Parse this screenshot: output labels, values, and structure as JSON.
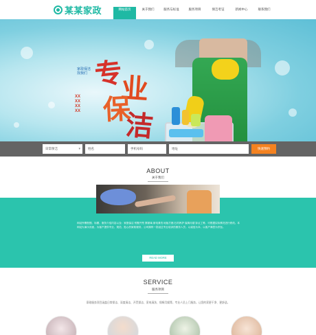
{
  "header": {
    "logo_text": "某某家政",
    "nav": [
      {
        "label": "网站首页",
        "active": true
      },
      {
        "label": "关于我们",
        "active": false
      },
      {
        "label": "服务与标准",
        "active": false
      },
      {
        "label": "服务项目",
        "active": false
      },
      {
        "label": "保洁考证",
        "active": false
      },
      {
        "label": "新闻中心",
        "active": false
      },
      {
        "label": "联系我们",
        "active": false
      }
    ]
  },
  "banner": {
    "calligraphy": [
      "专",
      "业",
      "保",
      "洁"
    ],
    "slogan_vertical": "家政保洁 找我们",
    "phone": "XXXXXXXX"
  },
  "search": {
    "select_value": "日常保洁",
    "name_placeholder": "姓名",
    "phone_placeholder": "手机号码",
    "address_placeholder": "地址",
    "submit_label": "快速预约"
  },
  "about": {
    "title": "ABOUT",
    "subtitle": "关于我们",
    "text": "网站所需配图、标题、服务介绍内容以及：家庭保洁 别墅开荒 擦玻璃 家电清洗 地板打蜡 石材养护 保姆月嫂 钟点工等，可根据实际情况进行修改。本网站为演示页面，为客户提供专业、规范、贴心的家政服务，公司拥有一批经过专业培训的服务人员，以诚信为本，以客户满意为宗旨。",
    "button_label": "READ MORE"
  },
  "service": {
    "title": "SERVICE",
    "subtitle": "服务项目",
    "text": "家政服务项目涵盖日常保洁、深度清洁、开荒保洁、家电清洗、保姆月嫂等，专业人员上门服务，让您的家更干净、更舒适。",
    "items": [
      "service-1",
      "service-2",
      "service-3",
      "service-4",
      "service-5"
    ]
  },
  "colors": {
    "brand_teal": "#1fb9a4",
    "band_teal": "#2bc4ad",
    "accent_orange": "#f48220",
    "search_bar_gray": "#646464"
  }
}
